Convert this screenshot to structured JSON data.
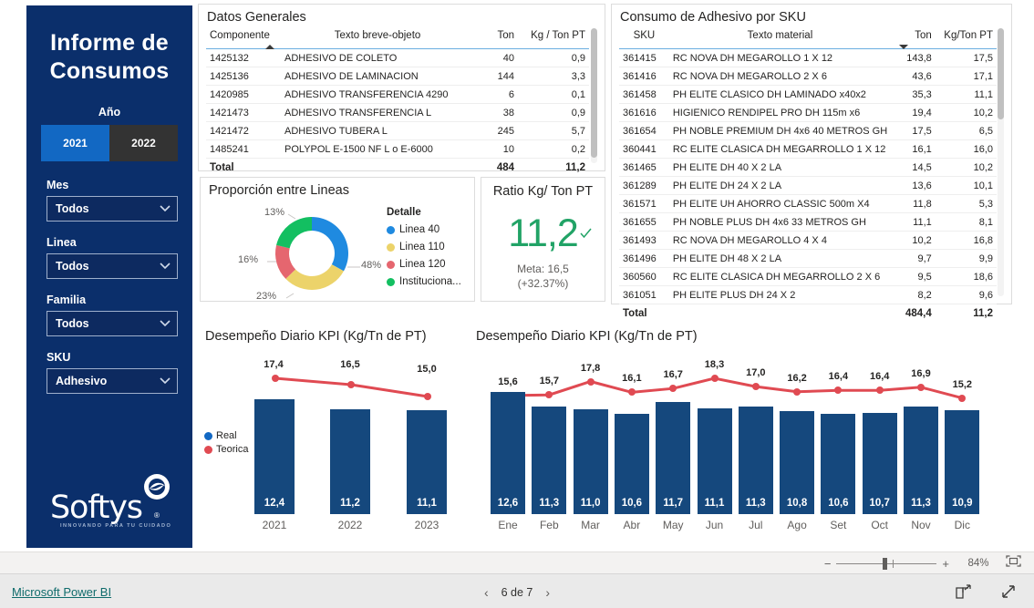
{
  "sidebar": {
    "title": "Informe de\nConsumos",
    "title_line1": "Informe de",
    "title_line2": "Consumos",
    "year_label": "Año",
    "years": [
      {
        "label": "2021",
        "selected": true
      },
      {
        "label": "2022",
        "selected": false
      }
    ],
    "slicers": [
      {
        "label": "Mes",
        "value": "Todos"
      },
      {
        "label": "Linea",
        "value": "Todos"
      },
      {
        "label": "Familia",
        "value": "Todos"
      },
      {
        "label": "SKU",
        "value": "Adhesivo"
      }
    ],
    "logo": {
      "word": "Softys",
      "registered": "®",
      "tagline": "INNOVANDO PARA TU CUIDADO"
    },
    "colors": {
      "background": "#0b2f6b",
      "selected_year": "#1268c3",
      "unselected_year": "#333333"
    }
  },
  "datos_generales": {
    "title": "Datos Generales",
    "columns": [
      "Componente",
      "Texto breve-objeto",
      "Ton",
      "Kg / Ton PT"
    ],
    "sort_column": "Componente",
    "sort_direction": "asc",
    "rows": [
      {
        "componente": "1425132",
        "texto": "ADHESIVO DE COLETO",
        "ton": "40",
        "kg": "0,9"
      },
      {
        "componente": "1425136",
        "texto": "ADHESIVO DE LAMINACION",
        "ton": "144",
        "kg": "3,3"
      },
      {
        "componente": "1420985",
        "texto": "ADHESIVO TRANSFERENCIA 4290",
        "ton": "6",
        "kg": "0,1"
      },
      {
        "componente": "1421473",
        "texto": "ADHESIVO TRANSFERENCIA L",
        "ton": "38",
        "kg": "0,9"
      },
      {
        "componente": "1421472",
        "texto": "ADHESIVO TUBERA L",
        "ton": "245",
        "kg": "5,7"
      },
      {
        "componente": "1485241",
        "texto": "POLYPOL E-1500 NF L o E-6000",
        "ton": "10",
        "kg": "0,2"
      }
    ],
    "total": {
      "label": "Total",
      "ton": "484",
      "kg": "11,2"
    }
  },
  "consumo_sku": {
    "title": "Consumo de Adhesivo por SKU",
    "columns": [
      "SKU",
      "Texto material",
      "Ton",
      "Kg/Ton PT"
    ],
    "sort_column": "Ton",
    "sort_direction": "desc",
    "rows": [
      {
        "sku": "361415",
        "texto": "RC NOVA DH MEGAROLLO 1 X 12",
        "ton": "143,8",
        "kg": "17,5"
      },
      {
        "sku": "361416",
        "texto": "RC NOVA DH MEGAROLLO 2 X 6",
        "ton": "43,6",
        "kg": "17,1"
      },
      {
        "sku": "361458",
        "texto": "PH ELITE CLASICO DH LAMINADO x40x2",
        "ton": "35,3",
        "kg": "11,1"
      },
      {
        "sku": "361616",
        "texto": "HIGIENICO RENDIPEL PRO DH 115m x6",
        "ton": "19,4",
        "kg": "10,2"
      },
      {
        "sku": "361654",
        "texto": "PH NOBLE PREMIUM DH 4x6 40 METROS GH",
        "ton": "17,5",
        "kg": "6,5"
      },
      {
        "sku": "360441",
        "texto": "RC ELITE CLASICA DH MEGARROLLO 1 X 12",
        "ton": "16,1",
        "kg": "16,0"
      },
      {
        "sku": "361465",
        "texto": "PH ELITE DH 40 X 2 LA",
        "ton": "14,5",
        "kg": "10,2"
      },
      {
        "sku": "361289",
        "texto": "PH ELITE DH 24 X 2 LA",
        "ton": "13,6",
        "kg": "10,1"
      },
      {
        "sku": "361571",
        "texto": "PH ELITE UH AHORRO CLASSIC 500m X4",
        "ton": "11,8",
        "kg": "5,3"
      },
      {
        "sku": "361655",
        "texto": "PH NOBLE PLUS DH 4x6 33 METROS GH",
        "ton": "11,1",
        "kg": "8,1"
      },
      {
        "sku": "361493",
        "texto": "RC NOVA DH MEGAROLLO 4 X 4",
        "ton": "10,2",
        "kg": "16,8"
      },
      {
        "sku": "361496",
        "texto": "PH ELITE DH 48 X 2 LA",
        "ton": "9,7",
        "kg": "9,9"
      },
      {
        "sku": "360560",
        "texto": "RC ELITE CLASICA DH MEGARROLLO 2 X 6",
        "ton": "9,5",
        "kg": "18,6"
      },
      {
        "sku": "361051",
        "texto": "PH ELITE PLUS DH 24 X 2",
        "ton": "8,2",
        "kg": "9,6"
      }
    ],
    "total": {
      "label": "Total",
      "ton": "484,4",
      "kg": "11,2"
    }
  },
  "proporcion": {
    "title": "Proporción entre Lineas",
    "legend_title": "Detalle"
  },
  "ratio_card": {
    "title": "Ratio Kg/ Ton PT",
    "value": "11,2",
    "meta": "Meta: 16,5",
    "delta": "(+32.37%)",
    "status_icon": "check-icon",
    "value_color": "#21a366"
  },
  "chart_yearly": {
    "title": "Desempeño Diario KPI (Kg/Tn de PT)",
    "legend": [
      {
        "label": "Real",
        "color": "#1268c3"
      },
      {
        "label": "Teorica",
        "color": "#e04a52"
      }
    ]
  },
  "chart_monthly": {
    "title": "Desempeño Diario KPI (Kg/Tn de PT)"
  },
  "statusbar": {
    "minus": "−",
    "plus": "+",
    "zoom": "84%",
    "fit_icon": "fit-to-page-icon"
  },
  "footer": {
    "brand": "Microsoft Power BI",
    "prev_icon": "chevron-left-icon",
    "next_icon": "chevron-right-icon",
    "page": "6 de 7",
    "share_icon": "share-icon",
    "expand_icon": "expand-icon"
  },
  "chart_data": [
    {
      "type": "pie",
      "title": "Proporción entre Lineas",
      "subtype": "donut",
      "legend_title": "Detalle",
      "legend_position": "right",
      "labels": [
        "Linea 40",
        "Linea 110",
        "Linea 120",
        "Instituciona..."
      ],
      "values": [
        48,
        23,
        16,
        13
      ],
      "display_labels": [
        "48%",
        "23%",
        "16%",
        "13%"
      ],
      "colors": [
        "#1f8ae0",
        "#ecd36a",
        "#e5666f",
        "#13bf61"
      ]
    },
    {
      "type": "bar",
      "title": "Desempeño Diario KPI (Kg/Tn de PT)",
      "xlabel": "",
      "ylabel": "",
      "categories": [
        "2021",
        "2022",
        "2023"
      ],
      "grid": false,
      "legend_position": "left",
      "series": [
        {
          "name": "Real",
          "type": "bar",
          "color": "#15487d",
          "values": [
            12.4,
            11.2,
            11.1
          ],
          "labels": [
            "12,4",
            "11,2",
            "11,1"
          ]
        },
        {
          "name": "Teorica",
          "type": "line",
          "color": "#e04a52",
          "values": [
            17.4,
            16.5,
            15.0
          ],
          "labels": [
            "17,4",
            "16,5",
            "15,0"
          ]
        }
      ]
    },
    {
      "type": "bar",
      "title": "Desempeño Diario KPI (Kg/Tn de PT)",
      "xlabel": "",
      "ylabel": "",
      "categories": [
        "Ene",
        "Feb",
        "Mar",
        "Abr",
        "May",
        "Jun",
        "Jul",
        "Ago",
        "Set",
        "Oct",
        "Nov",
        "Dic"
      ],
      "grid": false,
      "series": [
        {
          "name": "Real",
          "type": "bar",
          "color": "#15487d",
          "values": [
            12.6,
            11.3,
            11.0,
            10.6,
            11.7,
            11.1,
            11.3,
            10.8,
            10.6,
            10.7,
            11.3,
            10.9
          ],
          "labels": [
            "12,6",
            "11,3",
            "11,0",
            "10,6",
            "11,7",
            "11,1",
            "11,3",
            "10,8",
            "10,6",
            "10,7",
            "11,3",
            "10,9"
          ]
        },
        {
          "name": "Teorica",
          "type": "line",
          "color": "#e04a52",
          "values": [
            15.6,
            15.7,
            17.8,
            16.1,
            16.7,
            18.3,
            17.0,
            16.2,
            16.4,
            16.4,
            16.9,
            15.2
          ],
          "labels": [
            "15,6",
            "15,7",
            "17,8",
            "16,1",
            "16,7",
            "18,3",
            "17,0",
            "16,2",
            "16,4",
            "16,4",
            "16,9",
            "15,2"
          ]
        }
      ]
    }
  ]
}
